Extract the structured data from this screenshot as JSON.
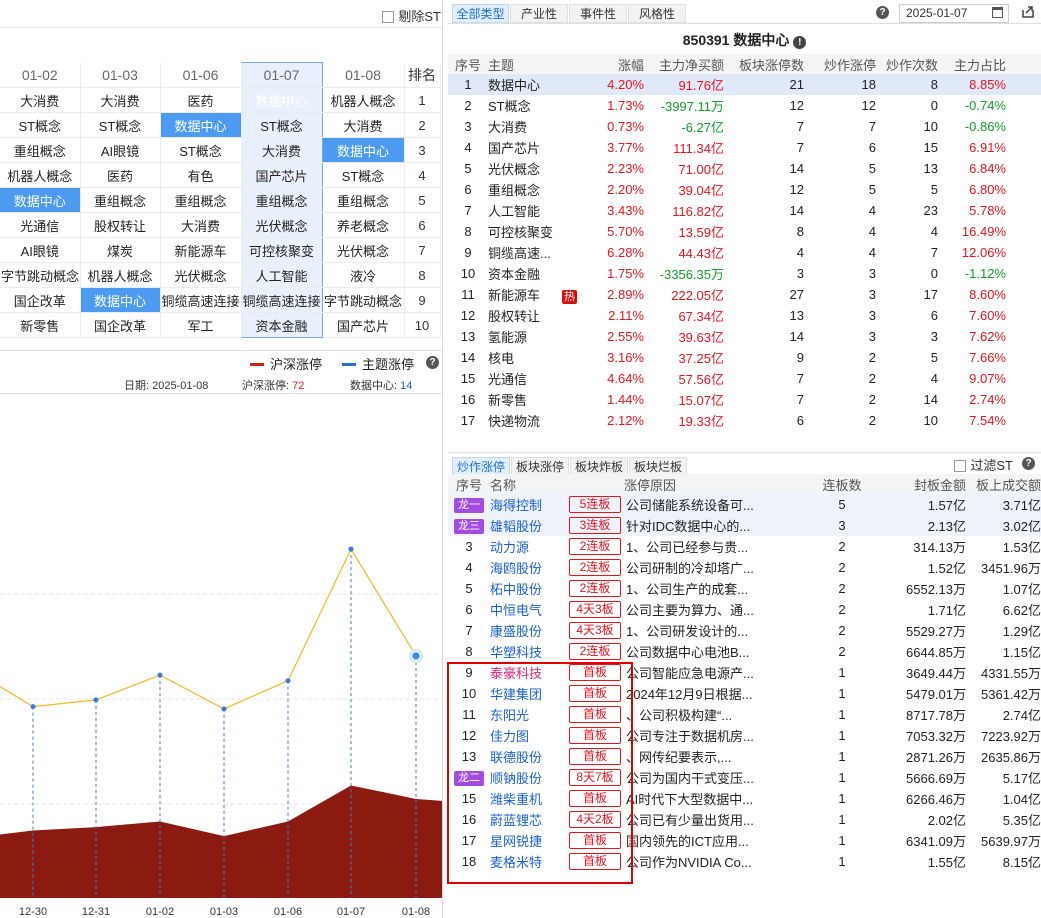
{
  "left": {
    "exclude_st_label": "剔除ST",
    "grid": {
      "headers": [
        "01-02",
        "01-03",
        "01-06",
        "01-07",
        "01-08",
        "排名"
      ],
      "rows": [
        [
          "大消费",
          "大消费",
          "医药",
          "数据中心",
          "机器人概念",
          "1"
        ],
        [
          "ST概念",
          "ST概念",
          "数据中心",
          "ST概念",
          "大消费",
          "2"
        ],
        [
          "重组概念",
          "AI眼镜",
          "ST概念",
          "大消费",
          "数据中心",
          "3"
        ],
        [
          "机器人概念",
          "医药",
          "有色",
          "国产芯片",
          "ST概念",
          "4"
        ],
        [
          "数据中心",
          "重组概念",
          "重组概念",
          "重组概念",
          "重组概念",
          "5"
        ],
        [
          "光通信",
          "股权转让",
          "大消费",
          "光伏概念",
          "养老概念",
          "6"
        ],
        [
          "AI眼镜",
          "煤炭",
          "新能源车",
          "可控核聚变",
          "光伏概念",
          "7"
        ],
        [
          "字节跳动概念",
          "机器人概念",
          "光伏概念",
          "人工智能",
          "液冷",
          "8"
        ],
        [
          "国企改革",
          "数据中心",
          "铜缆高速连接",
          "铜缆高速连接",
          "字节跳动概念",
          "9"
        ],
        [
          "新零售",
          "国企改革",
          "军工",
          "资本金融",
          "国产芯片",
          "10"
        ]
      ]
    },
    "legend": {
      "a": "沪深涨停",
      "b": "主题涨停"
    },
    "info": {
      "date_label": "日期:",
      "date": "2025-01-08",
      "hs_label": "沪深涨停:",
      "hs_value": "72",
      "dc_label": "数据中心:",
      "dc_value": "14"
    },
    "chart_data": {
      "type": "area",
      "categories": [
        "12-30",
        "12-31",
        "01-02",
        "01-03",
        "01-06",
        "01-07",
        "01-08"
      ],
      "series": [
        {
          "name": "沪深涨停",
          "values": [
            60,
            63,
            68,
            55,
            68,
            100,
            88
          ],
          "color": "#8b1a10"
        },
        {
          "name": "主题涨停",
          "values": [
            170,
            176,
            198,
            168,
            193,
            310,
            215
          ],
          "color": "#f2b928"
        }
      ],
      "ylim": [
        0,
        430
      ]
    }
  },
  "right": {
    "tabs": [
      "全部类型",
      "产业性",
      "事件性",
      "风格性"
    ],
    "date": "2025-01-07",
    "sector_title": "850391 数据中心",
    "sector_headers": [
      "序号",
      "主题",
      "涨幅",
      "主力净买额",
      "板块涨停数",
      "炒作涨停",
      "炒作次数",
      "主力占比"
    ],
    "sectors": [
      [
        "1",
        "数据中心",
        "4.20%",
        "91.76亿",
        "21",
        "18",
        "8",
        "8.85%"
      ],
      [
        "2",
        "ST概念",
        "1.73%",
        "-3997.11万",
        "12",
        "12",
        "0",
        "-0.74%"
      ],
      [
        "3",
        "大消费",
        "0.73%",
        "-6.27亿",
        "7",
        "7",
        "10",
        "-0.86%"
      ],
      [
        "4",
        "国产芯片",
        "3.77%",
        "111.34亿",
        "7",
        "6",
        "15",
        "6.91%"
      ],
      [
        "5",
        "光伏概念",
        "2.23%",
        "71.00亿",
        "14",
        "5",
        "13",
        "6.84%"
      ],
      [
        "6",
        "重组概念",
        "2.20%",
        "39.04亿",
        "12",
        "5",
        "5",
        "6.80%"
      ],
      [
        "7",
        "人工智能",
        "3.43%",
        "116.82亿",
        "14",
        "4",
        "23",
        "5.78%"
      ],
      [
        "8",
        "可控核聚变",
        "5.70%",
        "13.59亿",
        "8",
        "4",
        "4",
        "16.49%"
      ],
      [
        "9",
        "铜缆高速...",
        "6.28%",
        "44.43亿",
        "4",
        "4",
        "7",
        "12.06%"
      ],
      [
        "10",
        "资本金融",
        "1.75%",
        "-3356.35万",
        "3",
        "3",
        "0",
        "-1.12%"
      ],
      [
        "11",
        "新能源车",
        "2.89%",
        "222.05亿",
        "27",
        "3",
        "17",
        "8.60%"
      ],
      [
        "12",
        "股权转让",
        "2.11%",
        "67.34亿",
        "13",
        "3",
        "6",
        "7.60%"
      ],
      [
        "13",
        "氢能源",
        "2.55%",
        "39.63亿",
        "14",
        "3",
        "3",
        "7.62%"
      ],
      [
        "14",
        "核电",
        "3.16%",
        "37.25亿",
        "9",
        "2",
        "5",
        "7.66%"
      ],
      [
        "15",
        "光通信",
        "4.64%",
        "57.56亿",
        "7",
        "2",
        "4",
        "9.07%"
      ],
      [
        "16",
        "新零售",
        "1.44%",
        "15.07亿",
        "7",
        "2",
        "14",
        "2.74%"
      ],
      [
        "17",
        "快递物流",
        "2.12%",
        "19.33亿",
        "6",
        "2",
        "10",
        "7.54%"
      ]
    ],
    "hot_label": "热",
    "bottom_tabs": [
      "炒作涨停",
      "板块涨停",
      "板块炸板",
      "板块烂板"
    ],
    "filter_st_label": "过滤ST",
    "stock_headers": [
      "序号",
      "名称",
      "涨停原因",
      "连板数",
      "封板金额",
      "板上成交额"
    ],
    "stocks": [
      [
        "龙一",
        "海得控制",
        "5连板",
        "公司储能系统设备可...",
        "5",
        "1.57亿",
        "3.71亿"
      ],
      [
        "龙三",
        "雄韬股份",
        "3连板",
        "针对IDC数据中心的...",
        "3",
        "2.13亿",
        "3.02亿"
      ],
      [
        "3",
        "动力源",
        "2连板",
        "1、公司已经参与贵...",
        "2",
        "314.13万",
        "1.53亿"
      ],
      [
        "4",
        "海鸥股份",
        "2连板",
        "公司研制的冷却塔广...",
        "2",
        "1.52亿",
        "3451.96万"
      ],
      [
        "5",
        "柘中股份",
        "2连板",
        "1、公司生产的成套...",
        "2",
        "6552.13万",
        "1.07亿"
      ],
      [
        "6",
        "中恒电气",
        "4天3板",
        "公司主要为算力、通...",
        "2",
        "1.71亿",
        "6.62亿"
      ],
      [
        "7",
        "康盛股份",
        "4天3板",
        "1、公司研发设计的...",
        "2",
        "5529.27万",
        "1.29亿"
      ],
      [
        "8",
        "华塑科技",
        "2连板",
        "公司数据中心电池B...",
        "2",
        "6644.85万",
        "1.15亿"
      ],
      [
        "9",
        "泰豪科技",
        "首板",
        "公司智能应急电源产...",
        "1",
        "3649.44万",
        "4331.55万"
      ],
      [
        "10",
        "华建集团",
        "首板",
        "2024年12月9日根据...",
        "1",
        "5479.01万",
        "5361.42万"
      ],
      [
        "11",
        "东阳光",
        "首板",
        "、公司积极构建“...",
        "1",
        "8717.78万",
        "2.74亿"
      ],
      [
        "12",
        "佳力图",
        "首板",
        "公司专注于数据机房...",
        "1",
        "7053.32万",
        "7223.92万"
      ],
      [
        "13",
        "联德股份",
        "首板",
        "、网传纪要表示,...",
        "1",
        "2871.26万",
        "2635.86万"
      ],
      [
        "龙二",
        "顺钠股份",
        "8天7板",
        "公司为国内干式变压...",
        "1",
        "5666.69万",
        "5.17亿"
      ],
      [
        "15",
        "潍柴重机",
        "首板",
        "AI时代下大型数据中...",
        "1",
        "6266.46万",
        "1.04亿"
      ],
      [
        "16",
        "蔚蓝锂芯",
        "4天2板",
        "公司已有少量出货用...",
        "1",
        "2.02亿",
        "5.35亿"
      ],
      [
        "17",
        "星网锐捷",
        "首板",
        "国内领先的ICT应用...",
        "1",
        "6341.09万",
        "5639.97万"
      ],
      [
        "18",
        "麦格米特",
        "首板",
        "公司作为NVIDIA Co...",
        "1",
        "1.55亿",
        "8.15亿"
      ]
    ]
  }
}
